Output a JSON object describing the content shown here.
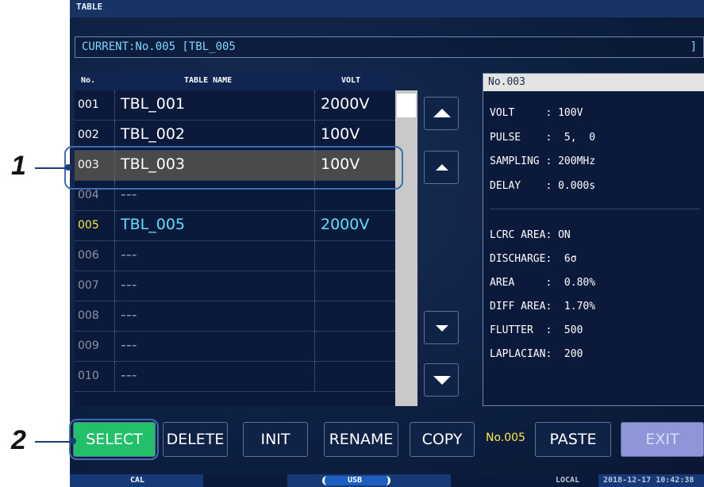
{
  "window_title": "TABLE",
  "current_label": "CURRENT:No.005 [TBL_005",
  "current_close": "]",
  "table_header": {
    "no": "No.",
    "name": "TABLE NAME",
    "volt": "VOLT"
  },
  "rows": [
    {
      "no": "001",
      "name": "TBL_001",
      "volt": "2000V"
    },
    {
      "no": "002",
      "name": "TBL_002",
      "volt": "100V"
    },
    {
      "no": "003",
      "name": "TBL_003",
      "volt": "100V"
    },
    {
      "no": "004",
      "name": "---",
      "volt": ""
    },
    {
      "no": "005",
      "name": "TBL_005",
      "volt": "2000V"
    },
    {
      "no": "006",
      "name": "---",
      "volt": ""
    },
    {
      "no": "007",
      "name": "---",
      "volt": ""
    },
    {
      "no": "008",
      "name": "---",
      "volt": ""
    },
    {
      "no": "009",
      "name": "---",
      "volt": ""
    },
    {
      "no": "010",
      "name": "---",
      "volt": ""
    }
  ],
  "info": {
    "header": "No.003",
    "lines": [
      "VOLT     : 100V",
      "PULSE    :  5,  0",
      "SAMPLING : 200MHz",
      "DELAY    : 0.000s",
      "LCRC AREA: ON",
      "DISCHARGE:  6σ",
      "AREA     :  0.80%",
      "DIFF AREA:  1.70%",
      "FLUTTER  :  500",
      "LAPLACIAN:  200"
    ]
  },
  "buttons": {
    "select": "SELECT",
    "delete": "DELETE",
    "init": "INIT",
    "rename": "RENAME",
    "copy": "COPY",
    "copy_no": "No.005",
    "paste": "PASTE",
    "exit": "EXIT"
  },
  "status": {
    "cal": "CAL",
    "usb": "USB",
    "local": "LOCAL",
    "datetime": "2018-12-17 10:42:38"
  },
  "callouts": {
    "one": "1",
    "two": "2"
  },
  "icons": [
    "scroll-up-fast-icon",
    "scroll-up-icon",
    "scroll-down-icon",
    "scroll-down-fast-icon"
  ],
  "colors": {
    "selected_green": "#22c06a",
    "exit_purple": "#8e95d9",
    "current_yellow": "#ffe94a",
    "current_cyan": "#5ce1ff"
  }
}
